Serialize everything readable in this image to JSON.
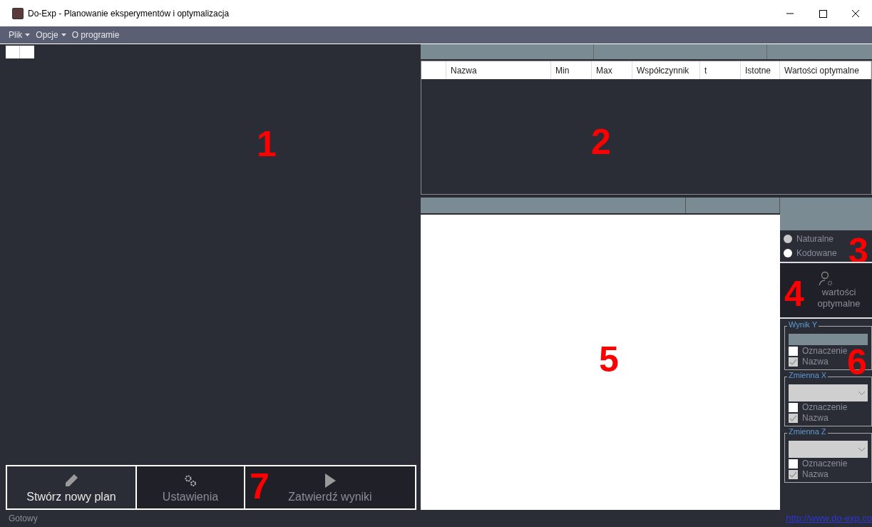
{
  "window": {
    "title": "Do-Exp - Planowanie eksperymentów i optymalizacja"
  },
  "menu": [
    {
      "label": "Plik",
      "has_dropdown": true
    },
    {
      "label": "Opcje",
      "has_dropdown": true
    },
    {
      "label": "O programie",
      "has_dropdown": false
    }
  ],
  "left_panel": {
    "marker": "1",
    "buttons": [
      {
        "label": "Stwórz nowy plan",
        "kind": "pencil",
        "disabled": false
      },
      {
        "label": "Ustawienia",
        "kind": "gears",
        "disabled": true
      },
      {
        "label": "Zatwierdź wyniki",
        "kind": "play",
        "disabled": true
      }
    ],
    "buttons_marker": "7"
  },
  "table": {
    "marker": "2",
    "columns": [
      "",
      "Nazwa",
      "Min",
      "Max",
      "Współczynnik",
      "t",
      "Istotne",
      "Wartości optymalne"
    ]
  },
  "chart_area": {
    "marker": "5"
  },
  "view_options": {
    "marker": "3",
    "radios": [
      {
        "label": "Naturalne",
        "selected": true
      },
      {
        "label": "Kodowane",
        "selected": false
      }
    ]
  },
  "optimal_button": {
    "label": "wartości optymalne",
    "marker": "4"
  },
  "groups_marker": "6",
  "groups": [
    {
      "title": "Wynik Y",
      "kind": "field",
      "options": [
        {
          "label": "Oznaczenie",
          "checked": false
        },
        {
          "label": "Nazwa",
          "checked": true
        }
      ]
    },
    {
      "title": "Zmienna X",
      "kind": "dropdown",
      "options": [
        {
          "label": "Oznaczenie",
          "checked": false
        },
        {
          "label": "Nazwa",
          "checked": true
        }
      ]
    },
    {
      "title": "Zmienna Z",
      "kind": "dropdown",
      "options": [
        {
          "label": "Oznaczenie",
          "checked": false
        },
        {
          "label": "Nazwa",
          "checked": true
        }
      ]
    }
  ],
  "status_bar": {
    "text": "Gotowy",
    "link": "http://www.do-exp.co"
  }
}
